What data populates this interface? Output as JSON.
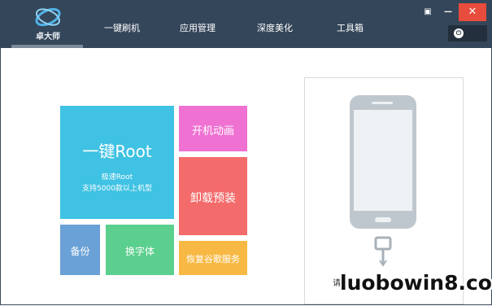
{
  "app": {
    "logo_text": "卓大师"
  },
  "nav": {
    "items": [
      {
        "label": "一键刷机"
      },
      {
        "label": "应用管理"
      },
      {
        "label": "深度美化"
      },
      {
        "label": "工具箱"
      }
    ]
  },
  "window": {
    "menu_glyph": "▣",
    "minimize_glyph": "—",
    "close_glyph": "✕"
  },
  "tiles": {
    "root": {
      "title": "一键Root",
      "sub1": "极速Root",
      "sub2": "支持5000款以上机型"
    },
    "boot": {
      "title": "开机动画"
    },
    "uninstall": {
      "title": "卸载预装"
    },
    "backup": {
      "title": "备份"
    },
    "font": {
      "title": "换字体"
    },
    "google": {
      "title": "恢复谷歌服务"
    }
  },
  "device": {
    "hint": "请"
  },
  "watermark": "luobowin8.com",
  "colors": {
    "titlebar": "#34465a",
    "root": "#3fc2e3",
    "boot": "#ef71d2",
    "uninstall": "#f36b6a",
    "backup": "#6aa1d6",
    "font": "#5bcf8e",
    "google": "#f7b944",
    "close": "#e74c3c"
  },
  "icons": [
    "logo-icon",
    "power-icon",
    "usb-icon",
    "phone-icon"
  ]
}
